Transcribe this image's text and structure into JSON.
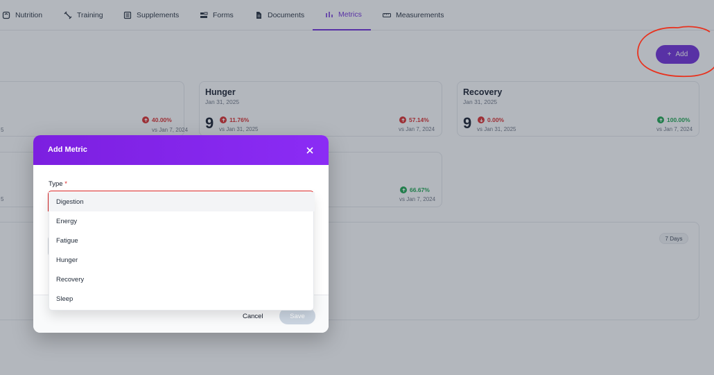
{
  "tabs": [
    {
      "label": "Nutrition",
      "icon": "scale-icon"
    },
    {
      "label": "Training",
      "icon": "dumbbell-icon"
    },
    {
      "label": "Supplements",
      "icon": "list-icon"
    },
    {
      "label": "Forms",
      "icon": "forms-icon"
    },
    {
      "label": "Documents",
      "icon": "document-icon"
    },
    {
      "label": "Metrics",
      "icon": "bar-chart-icon"
    },
    {
      "label": "Measurements",
      "icon": "ruler-icon"
    }
  ],
  "active_tab": "Metrics",
  "toolbar": {
    "add_label": "Add"
  },
  "cards": {
    "partial_left": {
      "value": "",
      "date_fragment": "5",
      "vs_fragment": "5",
      "delta": "40.00%",
      "delta_vs": "vs Jan 7, 2024"
    },
    "hunger": {
      "title": "Hunger",
      "date": "Jan 31, 2025",
      "value": "9",
      "delta1": "11.76%",
      "delta1_vs": "vs Jan 31, 2025",
      "delta2": "57.14%",
      "delta2_vs": "vs Jan 7, 2024"
    },
    "recovery": {
      "title": "Recovery",
      "date": "Jan 31, 2025",
      "value": "9",
      "delta1": "0.00%",
      "delta1_vs": "vs Jan 31, 2025",
      "delta2": "100.00%",
      "delta2_vs": "vs Jan 7, 2024"
    },
    "row2_partial": {
      "vs_fragment": "5",
      "delta": "66.67%",
      "delta_vs": "vs Jan 7, 2024"
    }
  },
  "chart_panel": {
    "range_label": "7 Days"
  },
  "modal": {
    "title": "Add Metric",
    "type_label": "Type",
    "required_mark": "*",
    "options": [
      "Digestion",
      "Energy",
      "Fatigue",
      "Hunger",
      "Recovery",
      "Sleep"
    ],
    "highlighted_option": "Digestion",
    "cancel_label": "Cancel",
    "save_label": "Save"
  },
  "colors": {
    "accent": "#6d28d9",
    "header": "#7c1fe0",
    "up_red": "#dc2626",
    "up_green": "#16a34a",
    "annotation": "#e8321e"
  }
}
